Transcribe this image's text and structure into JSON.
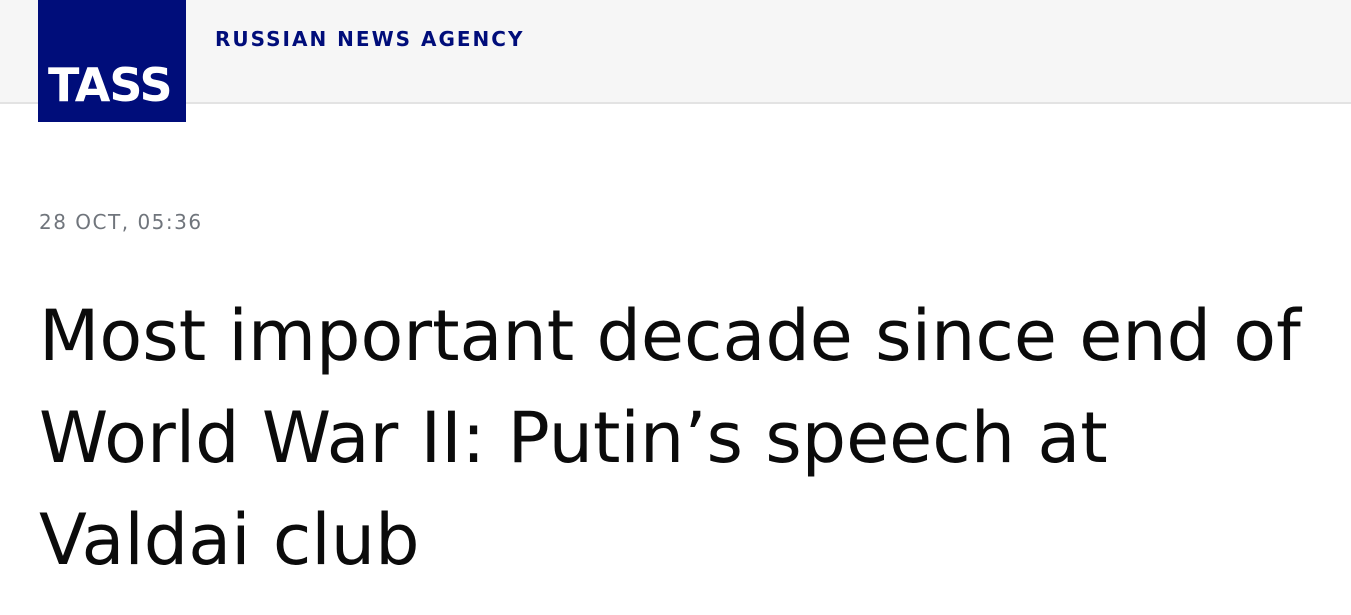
{
  "header": {
    "logo_text": "TASS",
    "tagline": "RUSSIAN NEWS AGENCY"
  },
  "article": {
    "dateline": "28 OCT, 05:36",
    "headline": "Most important decade since end of World War II: Putin’s speech at Valdai club"
  },
  "colors": {
    "brand": "#000d7a",
    "header_bg": "#f6f6f6",
    "dateline": "#70757c",
    "headline": "#0b0b0b"
  }
}
